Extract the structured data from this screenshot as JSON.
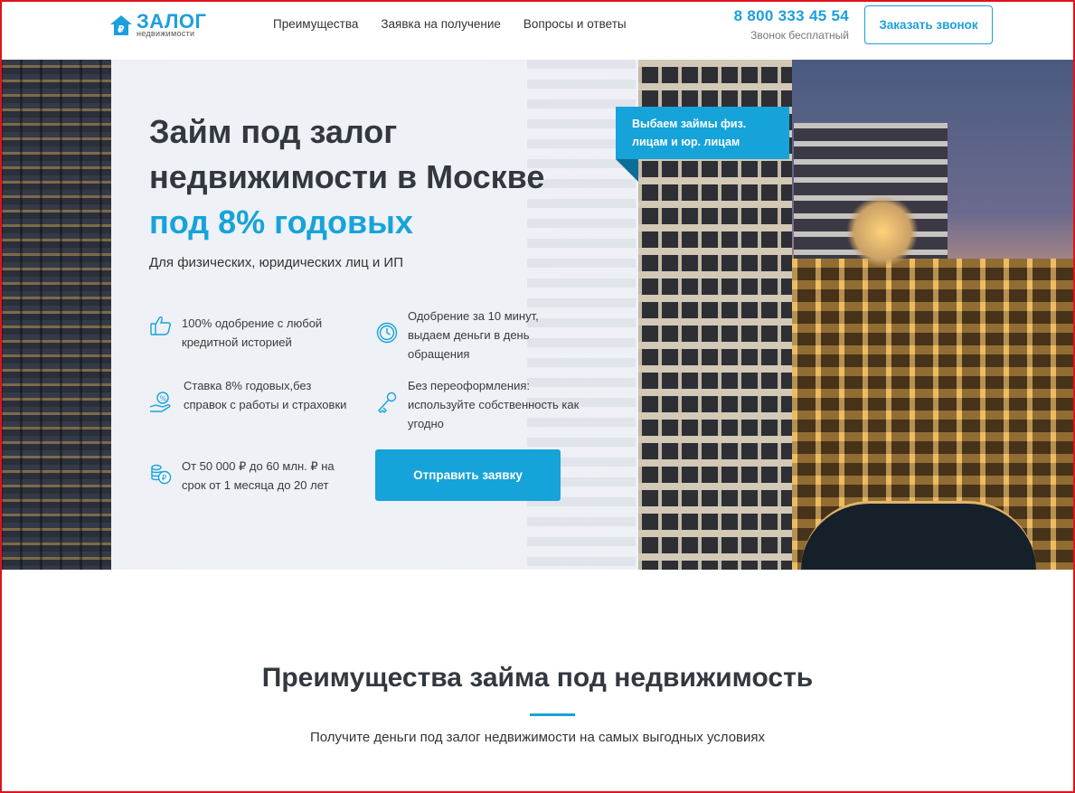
{
  "header": {
    "logo_title": "ЗАЛОГ",
    "logo_subtitle": "недвижимости",
    "nav": [
      {
        "label": "Преимущества"
      },
      {
        "label": "Заявка на получение"
      },
      {
        "label": "Вопросы и ответы"
      }
    ],
    "phone": "8 800 333 45 54",
    "phone_note": "Звонок бесплатный",
    "call_button": "Заказать звонок"
  },
  "hero": {
    "title_line1": "Займ под залог",
    "title_line2": "недвижимости в Москве",
    "title_accent": "под 8% годовых",
    "subtitle": "Для физических, юридических лиц и ИП",
    "badge": "Выбаем займы физ. лицам и юр. лицам",
    "features": [
      {
        "icon": "thumbs-up-icon",
        "text": "100% одобрение с любой кредитной историей"
      },
      {
        "icon": "clock-icon",
        "text": "Одобрение за 10 минут, выдаем деньги в день обращения"
      },
      {
        "icon": "percent-hand-icon",
        "text": "Ставка 8% годовых,без справок с работы и страховки"
      },
      {
        "icon": "key-icon",
        "text": "Без переоформления: используйте собственность как угодно"
      },
      {
        "icon": "coins-ruble-icon",
        "text": "От 50 000 ₽ до 60 млн. ₽ на срок от 1 месяца до 20 лет"
      }
    ],
    "cta": "Отправить заявку"
  },
  "advantages": {
    "title": "Преимущества займа под недвижимость",
    "subtitle": "Получите деньги под залог недвижимости на самых выгодных условиях"
  },
  "colors": {
    "accent": "#16a3d9",
    "text_dark": "#333840",
    "frame": "#e0141e"
  }
}
